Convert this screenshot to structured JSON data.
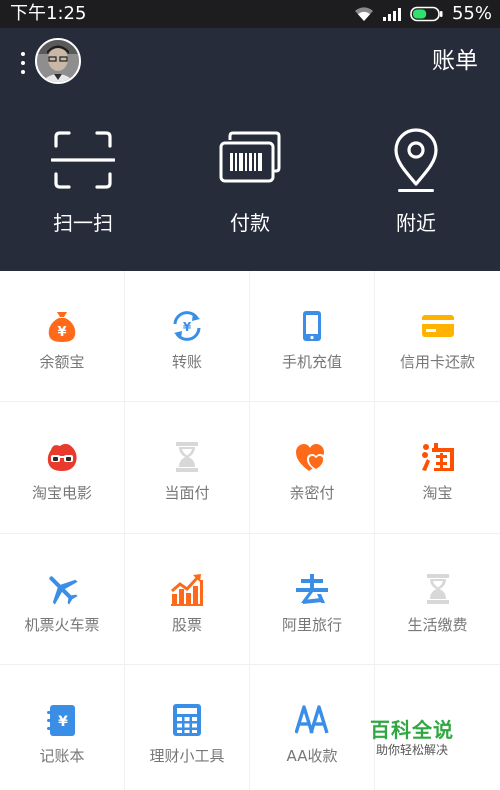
{
  "status_bar": {
    "time": "下午1:25",
    "battery_percent": "55%",
    "battery_level": 0.55
  },
  "header": {
    "bill_label": "账单",
    "quick_actions": [
      {
        "label": "扫一扫",
        "icon": "scan-icon"
      },
      {
        "label": "付款",
        "icon": "barcode-payment-icon"
      },
      {
        "label": "附近",
        "icon": "location-pin-icon"
      }
    ]
  },
  "colors": {
    "header_bg": "#272c3b",
    "status_bar_bg": "#1d1d1f",
    "orange": "#ff6a1a",
    "blue": "#3a8ee6",
    "yellow": "#ffb300",
    "red": "#e83b2e",
    "disabled": "#d8d8d8",
    "label": "#777777"
  },
  "services": [
    {
      "label": "余额宝",
      "icon": "yuebao-moneybag-icon"
    },
    {
      "label": "转账",
      "icon": "transfer-icon"
    },
    {
      "label": "手机充值",
      "icon": "mobile-recharge-icon"
    },
    {
      "label": "信用卡还款",
      "icon": "credit-card-icon"
    },
    {
      "label": "淘宝电影",
      "icon": "taobao-movie-icon"
    },
    {
      "label": "当面付",
      "icon": "hourglass-placeholder-icon"
    },
    {
      "label": "亲密付",
      "icon": "double-heart-icon"
    },
    {
      "label": "淘宝",
      "icon": "taobao-icon"
    },
    {
      "label": "机票火车票",
      "icon": "airplane-icon"
    },
    {
      "label": "股票",
      "icon": "stock-chart-icon"
    },
    {
      "label": "阿里旅行",
      "icon": "ali-travel-icon"
    },
    {
      "label": "生活缴费",
      "icon": "hourglass-placeholder-icon"
    },
    {
      "label": "记账本",
      "icon": "account-book-icon"
    },
    {
      "label": "理财小工具",
      "icon": "calculator-icon"
    },
    {
      "label": "AA收款",
      "icon": "aa-collect-icon"
    },
    {
      "label": "",
      "icon": ""
    }
  ],
  "watermark": {
    "title": "百科全说",
    "subtitle": "助你轻松解决"
  }
}
